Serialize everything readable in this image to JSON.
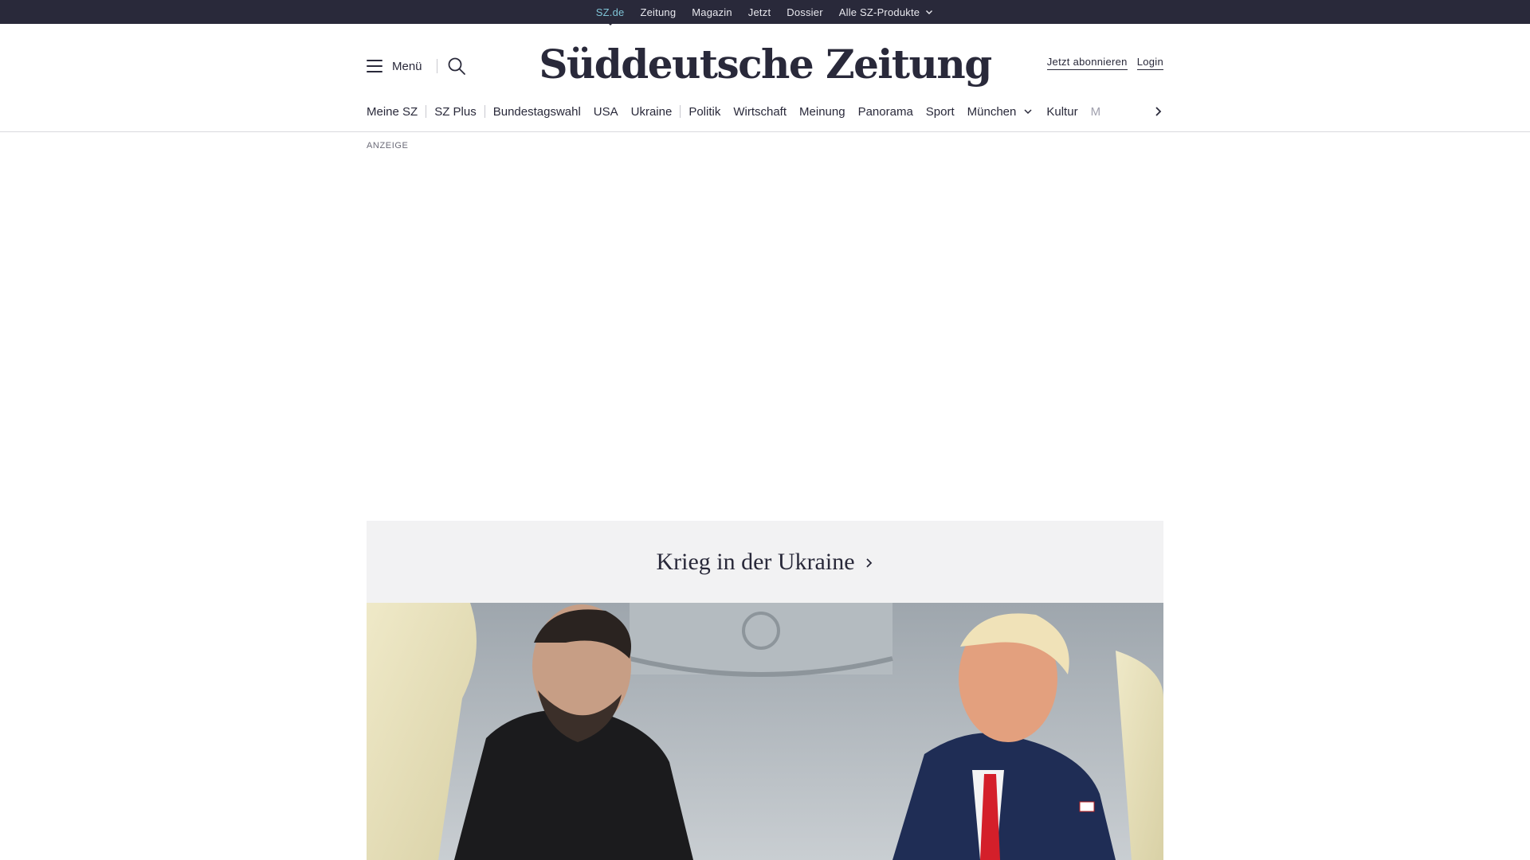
{
  "topbar": {
    "links": [
      "SZ.de",
      "Zeitung",
      "Magazin",
      "Jetzt",
      "Dossier",
      "Alle SZ-Produkte"
    ]
  },
  "header": {
    "menu_label": "Menü",
    "logo_text": "Süddeutsche Zeitung",
    "subscribe_label": "Jetzt abonnieren",
    "login_label": "Login"
  },
  "sections": [
    "Meine SZ",
    "SZ Plus",
    "Bundestagswahl",
    "USA",
    "Ukraine",
    "Politik",
    "Wirtschaft",
    "Meinung",
    "Panorama",
    "Sport",
    "München",
    "Kultur",
    "M"
  ],
  "ad": {
    "label": "ANZEIGE"
  },
  "topic": {
    "title": "Krieg in der Ukraine"
  },
  "colors": {
    "bar": "#29293a",
    "active": "#7fc3d6",
    "panel": "#f2f2f3"
  }
}
